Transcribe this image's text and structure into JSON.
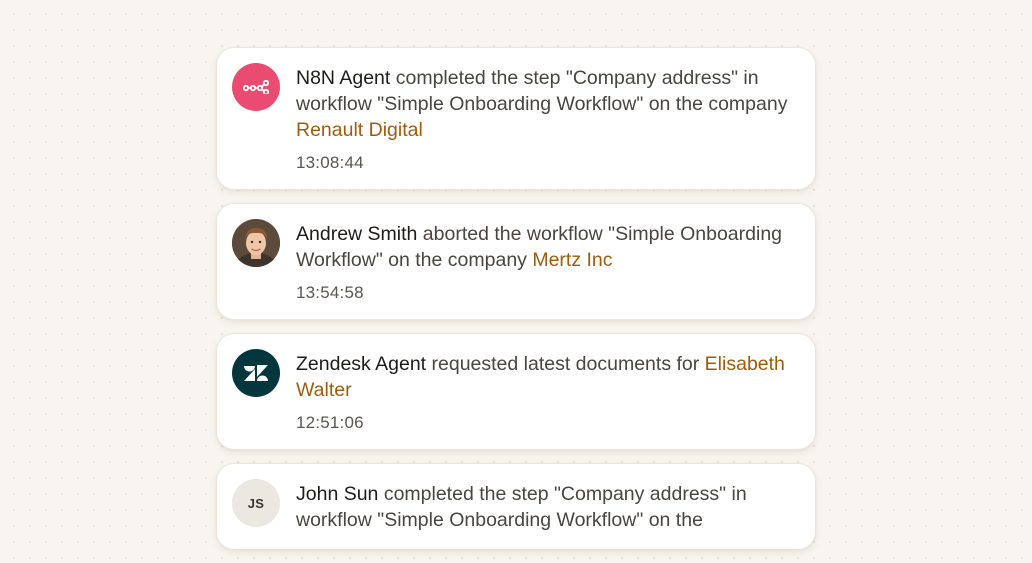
{
  "feed": {
    "items": [
      {
        "actor": "N8N Agent",
        "action": " completed the step \"Company address\" in workflow \"Simple Onboarding Workflow\" on the company ",
        "target": "Renault Digital",
        "time": "13:08:44",
        "avatar_icon": "n8n-logo-icon"
      },
      {
        "actor": "Andrew Smith",
        "action": " aborted the workflow \"Simple Onboarding Workflow\" on the company ",
        "target": "Mertz Inc",
        "time": "13:54:58",
        "avatar_icon": "user-photo"
      },
      {
        "actor": "Zendesk Agent",
        "action": " requested latest documents for ",
        "target": "Elisabeth Walter",
        "time": "12:51:06",
        "avatar_icon": "zendesk-logo-icon"
      },
      {
        "actor": "John Sun",
        "action": " completed the step \"Company address\" in workflow \"Simple Onboarding Workflow\" on the",
        "target": "",
        "time": "",
        "avatar_initials": "JS"
      }
    ]
  },
  "colors": {
    "background": "#f8f5f0",
    "link_accent": "#a15c0b",
    "n8n_brand": "#ea4b71",
    "zendesk_brand": "#03363d"
  }
}
